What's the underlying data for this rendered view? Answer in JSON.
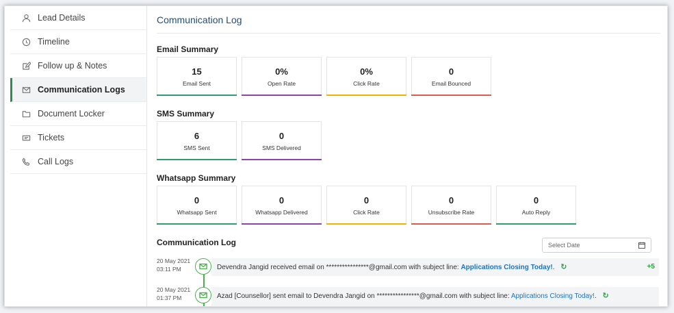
{
  "sidebar": {
    "items": [
      {
        "label": "Lead Details",
        "icon": "user-icon"
      },
      {
        "label": "Timeline",
        "icon": "clock-icon"
      },
      {
        "label": "Follow up & Notes",
        "icon": "edit-icon"
      },
      {
        "label": "Communication Logs",
        "icon": "mail-icon",
        "active": true
      },
      {
        "label": "Document Locker",
        "icon": "folder-icon"
      },
      {
        "label": "Tickets",
        "icon": "ticket-icon"
      },
      {
        "label": "Call Logs",
        "icon": "phone-icon"
      }
    ]
  },
  "main": {
    "title": "Communication Log",
    "email_summary": {
      "title": "Email Summary",
      "cards": [
        {
          "value": "15",
          "label": "Email Sent",
          "color": "#2e9e6e"
        },
        {
          "value": "0%",
          "label": "Open Rate",
          "color": "#8e44ad"
        },
        {
          "value": "0%",
          "label": "Click Rate",
          "color": "#f0b400"
        },
        {
          "value": "0",
          "label": "Email Bounced",
          "color": "#e05a4f"
        }
      ]
    },
    "sms_summary": {
      "title": "SMS Summary",
      "cards": [
        {
          "value": "6",
          "label": "SMS Sent",
          "color": "#2e9e6e"
        },
        {
          "value": "0",
          "label": "SMS Delivered",
          "color": "#8e44ad"
        }
      ]
    },
    "whatsapp_summary": {
      "title": "Whatsapp Summary",
      "cards": [
        {
          "value": "0",
          "label": "Whatsapp Sent",
          "color": "#2e9e6e"
        },
        {
          "value": "0",
          "label": "Whatsapp Delivered",
          "color": "#8e44ad"
        },
        {
          "value": "0",
          "label": "Click Rate",
          "color": "#f0b400"
        },
        {
          "value": "0",
          "label": "Unsubscribe Rate",
          "color": "#e05a4f"
        },
        {
          "value": "0",
          "label": "Auto Reply",
          "color": "#2e9e6e"
        }
      ]
    },
    "log": {
      "title": "Communication Log",
      "date_placeholder": "Select Date",
      "entries": [
        {
          "date": "20 May 2021",
          "time": "03:11 PM",
          "text": "Devendra Jangid received email on ****************@gmail.com with subject line: ",
          "subject": "Applications Closing Today!",
          "suffix": ".",
          "extra": "+5"
        },
        {
          "date": "20 May 2021",
          "time": "01:37 PM",
          "text": "Azad [Counsellor] sent email to Devendra Jangid on ****************@gmail.com with subject line: ",
          "subject": "Applications Closing Today!",
          "suffix": "."
        }
      ]
    }
  },
  "colors": {
    "accent": "#1f4e79",
    "active_bar": "#2e8b57",
    "timeline": "#4caf50",
    "link": "#1e73be"
  }
}
